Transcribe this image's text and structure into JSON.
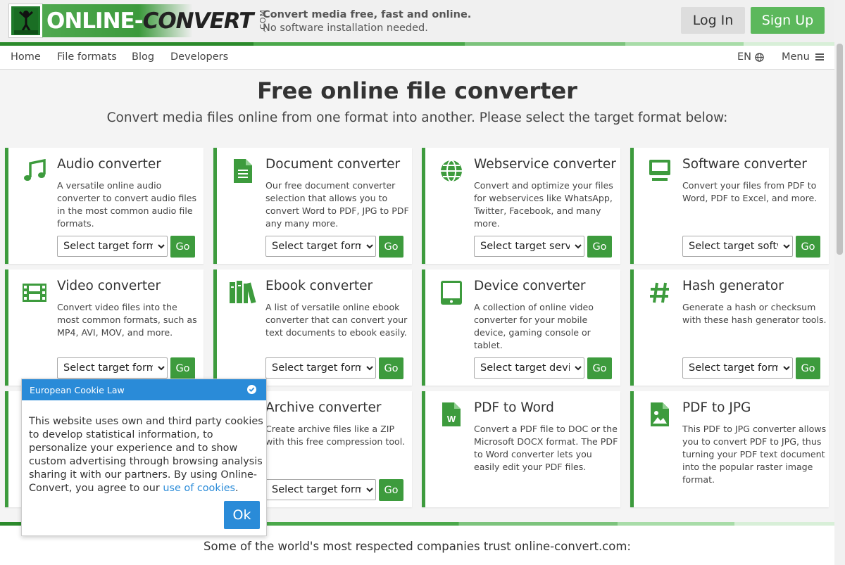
{
  "header": {
    "logo_text_online": "ONLINE-",
    "logo_text_convert": "CONVERT",
    "logo_com": ".COM",
    "tagline_1": "Convert media free, fast and online.",
    "tagline_2": "No software installation needed.",
    "login_label": "Log In",
    "signup_label": "Sign Up"
  },
  "nav": {
    "items": [
      {
        "label": "Home"
      },
      {
        "label": "File formats"
      },
      {
        "label": "Blog"
      },
      {
        "label": "Developers"
      }
    ],
    "language": "EN",
    "menu_label": "Menu"
  },
  "hero": {
    "title": "Free online file converter",
    "subtitle": "Convert media files online from one format into another. Please select the target format below:"
  },
  "cards": [
    {
      "title": "Audio converter",
      "desc": "A versatile online audio converter to convert audio files in the most common audio file formats.",
      "select": "Select target format",
      "go": "Go",
      "icon": "music-icon"
    },
    {
      "title": "Document converter",
      "desc": "Our free document converter selection that allows you to convert Word to PDF, JPG to PDF any many more.",
      "select": "Select target format",
      "go": "Go",
      "icon": "document-icon"
    },
    {
      "title": "Webservice converter",
      "desc": "Convert and optimize your files for webservices like WhatsApp, Twitter, Facebook, and many more.",
      "select": "Select target service",
      "go": "Go",
      "icon": "globe-icon"
    },
    {
      "title": "Software converter",
      "desc": "Convert your files from PDF to Word, PDF to Excel, and more.",
      "select": "Select target software",
      "go": "Go",
      "icon": "monitor-icon"
    },
    {
      "title": "Video converter",
      "desc": "Convert video files into the most common formats, such as MP4, AVI, MOV, and more.",
      "select": "Select target format",
      "go": "Go",
      "icon": "film-icon"
    },
    {
      "title": "Ebook converter",
      "desc": "A list of versatile online ebook converter that can convert your text documents to ebook easily.",
      "select": "Select target format",
      "go": "Go",
      "icon": "books-icon"
    },
    {
      "title": "Device converter",
      "desc": "A collection of online video converter for your mobile device, gaming console or tablet.",
      "select": "Select target device",
      "go": "Go",
      "icon": "tablet-icon"
    },
    {
      "title": "Hash generator",
      "desc": "Generate a hash or checksum with these hash generator tools.",
      "select": "Select target format",
      "go": "Go",
      "icon": "hash-icon"
    },
    {
      "title": "Archive converter",
      "desc": "Create archive files like a ZIP with this free compression tool.",
      "select": "Select target format",
      "go": "Go",
      "icon": "archive-icon"
    },
    {
      "title": "PDF to Word",
      "desc": "Convert a PDF file to DOC or the Microsoft DOCX format. The PDF to Word converter lets you easily edit your PDF files.",
      "icon": "word-file-icon"
    },
    {
      "title": "PDF to JPG",
      "desc": "This PDF to JPG converter allows you to convert PDF to JPG, thus turning your PDF text document into the popular raster image format.",
      "icon": "image-file-icon"
    }
  ],
  "trust_text": "Some of the world's most respected companies trust online-convert.com:",
  "cookie": {
    "title": "European Cookie Law",
    "body": "This website uses own and third party cookies to develop statistical information, to personalize your experience and to show custom advertising through browsing analysis sharing it with our partners. By using Online-Convert, you agree to our ",
    "link": "use of cookies",
    "period": ".",
    "ok_label": "Ok"
  },
  "colors": {
    "brand_green": "#3d9b3d",
    "signup_green": "#5cb85c",
    "cookie_blue": "#2a8bd8"
  }
}
